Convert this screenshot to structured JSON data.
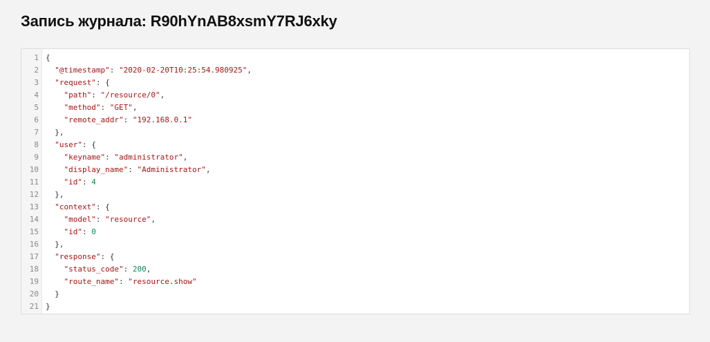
{
  "header": {
    "title": "Запись журнала: R90hYnAB8xsmY7RJ6xky"
  },
  "log_entry": {
    "lines": [
      {
        "n": "1",
        "parts": [
          {
            "t": "p",
            "v": "{"
          }
        ]
      },
      {
        "n": "2",
        "parts": [
          {
            "t": "p",
            "v": "  "
          },
          {
            "t": "k",
            "v": "\"@timestamp\""
          },
          {
            "t": "p",
            "v": ": "
          },
          {
            "t": "s",
            "v": "\"2020-02-20T10:25:54.980925\""
          },
          {
            "t": "p",
            "v": ","
          }
        ]
      },
      {
        "n": "3",
        "parts": [
          {
            "t": "p",
            "v": "  "
          },
          {
            "t": "k",
            "v": "\"request\""
          },
          {
            "t": "p",
            "v": ": {"
          }
        ]
      },
      {
        "n": "4",
        "parts": [
          {
            "t": "p",
            "v": "    "
          },
          {
            "t": "k",
            "v": "\"path\""
          },
          {
            "t": "p",
            "v": ": "
          },
          {
            "t": "s",
            "v": "\"/resource/0\""
          },
          {
            "t": "p",
            "v": ","
          }
        ]
      },
      {
        "n": "5",
        "parts": [
          {
            "t": "p",
            "v": "    "
          },
          {
            "t": "k",
            "v": "\"method\""
          },
          {
            "t": "p",
            "v": ": "
          },
          {
            "t": "s",
            "v": "\"GET\""
          },
          {
            "t": "p",
            "v": ","
          }
        ]
      },
      {
        "n": "6",
        "parts": [
          {
            "t": "p",
            "v": "    "
          },
          {
            "t": "k",
            "v": "\"remote_addr\""
          },
          {
            "t": "p",
            "v": ": "
          },
          {
            "t": "s",
            "v": "\"192.168.0.1\""
          }
        ]
      },
      {
        "n": "7",
        "parts": [
          {
            "t": "p",
            "v": "  },"
          }
        ]
      },
      {
        "n": "8",
        "parts": [
          {
            "t": "p",
            "v": "  "
          },
          {
            "t": "k",
            "v": "\"user\""
          },
          {
            "t": "p",
            "v": ": {"
          }
        ]
      },
      {
        "n": "9",
        "parts": [
          {
            "t": "p",
            "v": "    "
          },
          {
            "t": "k",
            "v": "\"keyname\""
          },
          {
            "t": "p",
            "v": ": "
          },
          {
            "t": "s",
            "v": "\"administrator\""
          },
          {
            "t": "p",
            "v": ","
          }
        ]
      },
      {
        "n": "10",
        "parts": [
          {
            "t": "p",
            "v": "    "
          },
          {
            "t": "k",
            "v": "\"display_name\""
          },
          {
            "t": "p",
            "v": ": "
          },
          {
            "t": "s",
            "v": "\"Administrator\""
          },
          {
            "t": "p",
            "v": ","
          }
        ]
      },
      {
        "n": "11",
        "parts": [
          {
            "t": "p",
            "v": "    "
          },
          {
            "t": "k",
            "v": "\"id\""
          },
          {
            "t": "p",
            "v": ": "
          },
          {
            "t": "n",
            "v": "4"
          }
        ]
      },
      {
        "n": "12",
        "parts": [
          {
            "t": "p",
            "v": "  },"
          }
        ]
      },
      {
        "n": "13",
        "parts": [
          {
            "t": "p",
            "v": "  "
          },
          {
            "t": "k",
            "v": "\"context\""
          },
          {
            "t": "p",
            "v": ": {"
          }
        ]
      },
      {
        "n": "14",
        "parts": [
          {
            "t": "p",
            "v": "    "
          },
          {
            "t": "k",
            "v": "\"model\""
          },
          {
            "t": "p",
            "v": ": "
          },
          {
            "t": "s",
            "v": "\"resource\""
          },
          {
            "t": "p",
            "v": ","
          }
        ]
      },
      {
        "n": "15",
        "parts": [
          {
            "t": "p",
            "v": "    "
          },
          {
            "t": "k",
            "v": "\"id\""
          },
          {
            "t": "p",
            "v": ": "
          },
          {
            "t": "n",
            "v": "0"
          }
        ]
      },
      {
        "n": "16",
        "parts": [
          {
            "t": "p",
            "v": "  },"
          }
        ]
      },
      {
        "n": "17",
        "parts": [
          {
            "t": "p",
            "v": "  "
          },
          {
            "t": "k",
            "v": "\"response\""
          },
          {
            "t": "p",
            "v": ": {"
          }
        ]
      },
      {
        "n": "18",
        "parts": [
          {
            "t": "p",
            "v": "    "
          },
          {
            "t": "k",
            "v": "\"status_code\""
          },
          {
            "t": "p",
            "v": ": "
          },
          {
            "t": "n",
            "v": "200"
          },
          {
            "t": "p",
            "v": ","
          }
        ]
      },
      {
        "n": "19",
        "parts": [
          {
            "t": "p",
            "v": "    "
          },
          {
            "t": "k",
            "v": "\"route_name\""
          },
          {
            "t": "p",
            "v": ": "
          },
          {
            "t": "s",
            "v": "\"resource.show\""
          }
        ]
      },
      {
        "n": "20",
        "parts": [
          {
            "t": "p",
            "v": "  }"
          }
        ]
      },
      {
        "n": "21",
        "parts": [
          {
            "t": "p",
            "v": "}"
          }
        ]
      }
    ]
  },
  "colors": {
    "page_background": "#f3f3f3",
    "key_and_string": "#a31515",
    "number": "#09885a",
    "line_number": "#888888"
  }
}
